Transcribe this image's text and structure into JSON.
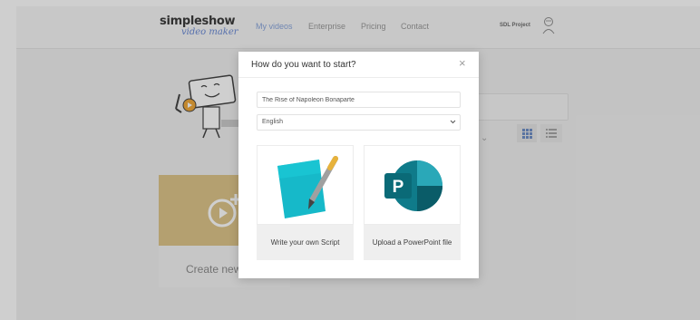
{
  "app": {
    "logo_main": "simpleshow",
    "logo_sub": "video maker",
    "nav": [
      {
        "label": "My videos",
        "active": true
      },
      {
        "label": "Enterprise",
        "active": false
      },
      {
        "label": "Pricing",
        "active": false
      },
      {
        "label": "Contact",
        "active": false
      }
    ],
    "project_label": "SDL Project",
    "create_card_label": "Create new v"
  },
  "modal": {
    "title": "How do you want to start?",
    "title_input_value": "The Rise of Napoleon Bonaparte",
    "language_value": "English",
    "options": [
      {
        "label": "Write your own Script",
        "icon": "paper-pen-icon"
      },
      {
        "label": "Upload a PowerPoint file",
        "icon": "powerpoint-icon"
      }
    ]
  },
  "colors": {
    "accent": "#8aa6dc",
    "create_card": "#dec58b",
    "script_paper": "#16b9c9",
    "ppt_teal": "#0f7b8a",
    "ppt_dark": "#0a5c68"
  }
}
